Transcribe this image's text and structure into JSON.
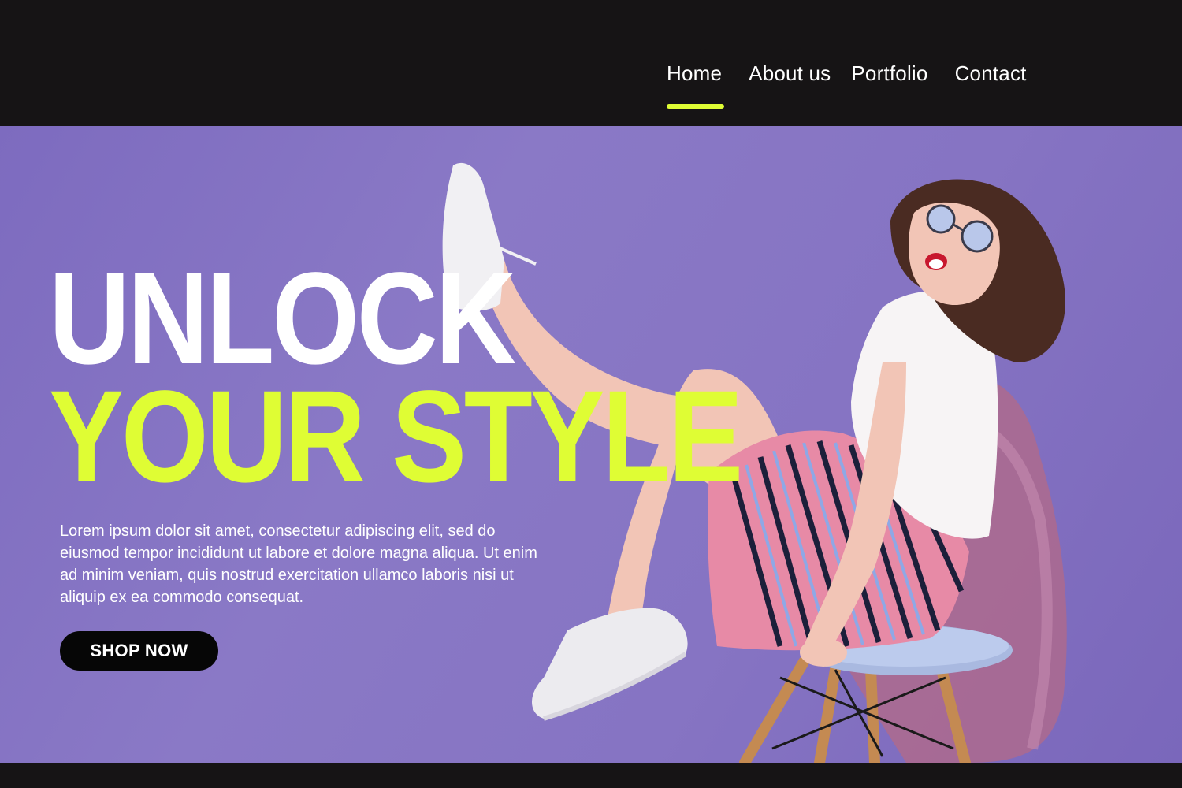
{
  "nav": {
    "items": [
      {
        "label": "Home",
        "active": true
      },
      {
        "label": "About us",
        "active": false
      },
      {
        "label": "Portfolio",
        "active": false
      },
      {
        "label": "Contact",
        "active": false
      }
    ],
    "active_indicator_color": "#dffd34"
  },
  "hero": {
    "headline_line1": "UNLOCK",
    "headline_line2": "YOUR STYLE",
    "body": "Lorem ipsum dolor sit amet, consectetur adipiscing elit, sed do eiusmod tempor incididunt ut labore et dolore magna aliqua. Ut enim ad minim veniam, quis nostrud exercitation ullamco laboris nisi ut aliquip ex ea commodo consequat.",
    "cta_label": "SHOP NOW",
    "background_color": "#8674c3",
    "accent_color": "#dffd34",
    "image_subject": "woman-on-chair-photo"
  }
}
